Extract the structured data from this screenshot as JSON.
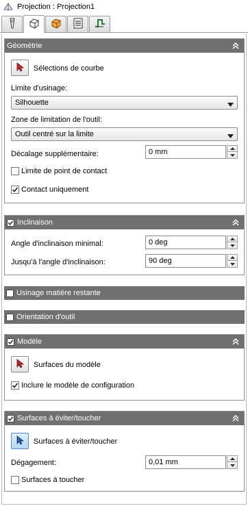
{
  "title": "Projection : Projection1",
  "tabs": [
    {
      "icon": "tool-icon",
      "active": false
    },
    {
      "icon": "pattern-icon",
      "active": true
    },
    {
      "icon": "stock-box-icon",
      "active": false
    },
    {
      "icon": "list-settings-icon",
      "active": false
    },
    {
      "icon": "link-icon",
      "active": false
    }
  ],
  "geometrie": {
    "header": "Géométrie",
    "curve_button": "Sélections de courbe",
    "limit_label": "Limite d'usinage:",
    "limit_value": "Silhouette",
    "zone_label": "Zone de limitation de l'outil:",
    "zone_value": "Outil centré sur la limite",
    "offset_label": "Décalage supplémentaire:",
    "offset_value": "0 mm",
    "contact_limit_label": "Limite de point de contact",
    "contact_limit_checked": false,
    "contact_only_label": "Contact uniquement",
    "contact_only_checked": true
  },
  "inclinaison": {
    "header": "Inclinaison",
    "checked": true,
    "min_label": "Angle d'inclinaison minimal:",
    "min_value": "0 deg",
    "max_label": "Jusqu'à l'angle d'inclinaison:",
    "max_value": "90 deg"
  },
  "rest_machining": {
    "header": "Usinage matière restante",
    "checked": false
  },
  "tool_orientation": {
    "header": "Orientation d'outil",
    "checked": false
  },
  "modele": {
    "header": "Modèle",
    "checked": true,
    "surfaces_button": "Surfaces du modèle",
    "include_setup_label": "Inclure le modèle de configuration",
    "include_setup_checked": true
  },
  "avoid": {
    "header": "Surfaces à éviter/toucher",
    "checked": true,
    "surfaces_button": "Surfaces à éviter/toucher",
    "clearance_label": "Dégagement:",
    "clearance_value": "0,01 mm",
    "touch_label": "Surfaces à toucher",
    "touch_checked": false
  },
  "colors": {
    "header_bg": "#707070",
    "pick_arrow": "#b02020",
    "active_pick_arrow": "#1a4f8a"
  }
}
